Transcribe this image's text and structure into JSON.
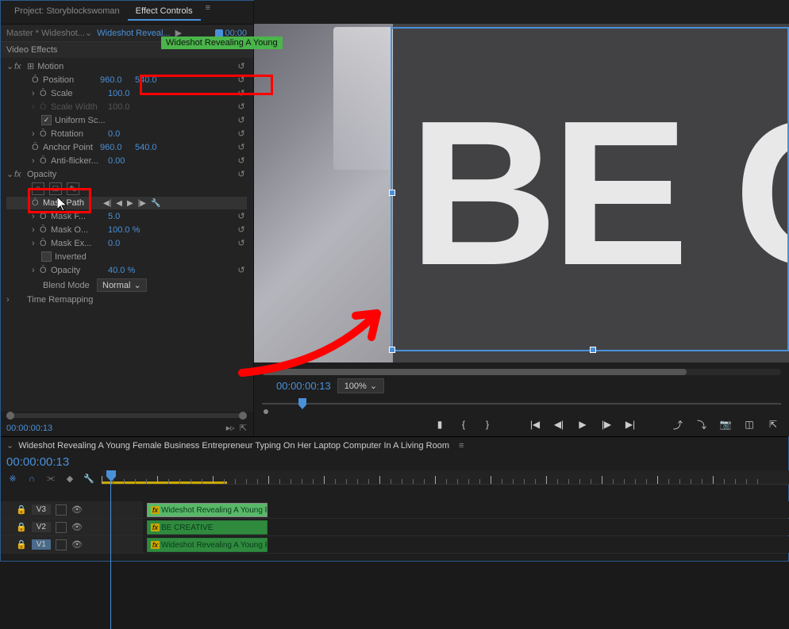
{
  "panel_tabs": {
    "project": "Project: Storyblockswoman",
    "effect_controls": "Effect Controls"
  },
  "source_row": {
    "master": "Master * Wideshot...",
    "clip": "Wideshot Reveal...",
    "time": "00:00",
    "tooltip": "Wideshot Revealing A Young"
  },
  "sections": {
    "video_effects": "Video Effects"
  },
  "motion": {
    "label": "Motion",
    "position": {
      "label": "Position",
      "x": "960.0",
      "y": "540.0"
    },
    "scale": {
      "label": "Scale",
      "val": "100.0"
    },
    "scale_width": {
      "label": "Scale Width",
      "val": "100.0"
    },
    "uniform": {
      "label": "Uniform Sc..."
    },
    "rotation": {
      "label": "Rotation",
      "val": "0.0"
    },
    "anchor": {
      "label": "Anchor Point",
      "x": "960.0",
      "y": "540.0"
    },
    "antiflicker": {
      "label": "Anti-flicker...",
      "val": "0.00"
    }
  },
  "opacity": {
    "label": "Opacity",
    "mask_path": {
      "label": "Mask Path"
    },
    "mask_opacity": {
      "label": "Mask O...",
      "val": "100.0 %"
    },
    "mask_expansion": {
      "label": "Mask Ex...",
      "val": "0.0"
    },
    "inverted": {
      "label": "Inverted"
    },
    "opacity_val": {
      "label": "Opacity",
      "val": "40.0 %"
    },
    "blend": {
      "label": "Blend Mode",
      "val": "Normal"
    }
  },
  "time_remap": {
    "label": "Time Remapping"
  },
  "footer_time": "00:00:00:13",
  "preview": {
    "big_text": "BE CR",
    "timecode": "00:00:00:13",
    "zoom": "100%"
  },
  "sequence": {
    "name": "Wideshot Revealing A Young Female Business Entrepreneur Typing On Her Laptop Computer In A Living Room",
    "timecode": "00:00:00:13",
    "tracks": [
      "V3",
      "V2",
      "V1"
    ],
    "clips": {
      "v3": "Wideshot Revealing A Young Female Busi",
      "v2": "BE CREATIVE",
      "v1": "Wideshot Revealing A Young Female Busi"
    }
  }
}
